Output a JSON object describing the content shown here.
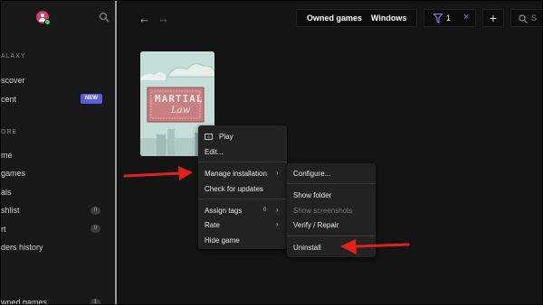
{
  "sidebar": {
    "section_galaxy": "ALAXY",
    "discover": "scover",
    "recent": "cent",
    "new_badge": "NEW",
    "section_store": "ORE",
    "home": "me",
    "games": "games",
    "deals": "als",
    "wishlist": "shlist",
    "wishlist_count": "0",
    "cart": "rt",
    "cart_count": "0",
    "orders": "ders history",
    "owned_games": "wned games",
    "owned_count": "1"
  },
  "topbar": {
    "back_icon": "←",
    "forward_icon": "→",
    "tab_owned": "Owned games",
    "tab_platform": "Windows",
    "filter_count": "1",
    "filter_clear": "×",
    "add_label": "+",
    "search_placeholder": "S"
  },
  "game": {
    "title_line1": "MARTIAL",
    "title_line2": "Law"
  },
  "menu": {
    "play": "Play",
    "edit": "Edit...",
    "manage": "Manage installation",
    "check_updates": "Check for updates",
    "assign_tags": "Assign tags",
    "tags_count": "0",
    "rate": "Rate",
    "hide": "Hide game"
  },
  "submenu": {
    "configure": "Configure...",
    "show_folder": "Show folder",
    "show_screenshots": "Show screenshots",
    "verify": "Verify / Repair",
    "uninstall": "Uninstall"
  },
  "colors": {
    "accent_red": "#e0201b",
    "badge_purple": "#5b5ed6",
    "avatar_pink": "#d23a6b"
  }
}
